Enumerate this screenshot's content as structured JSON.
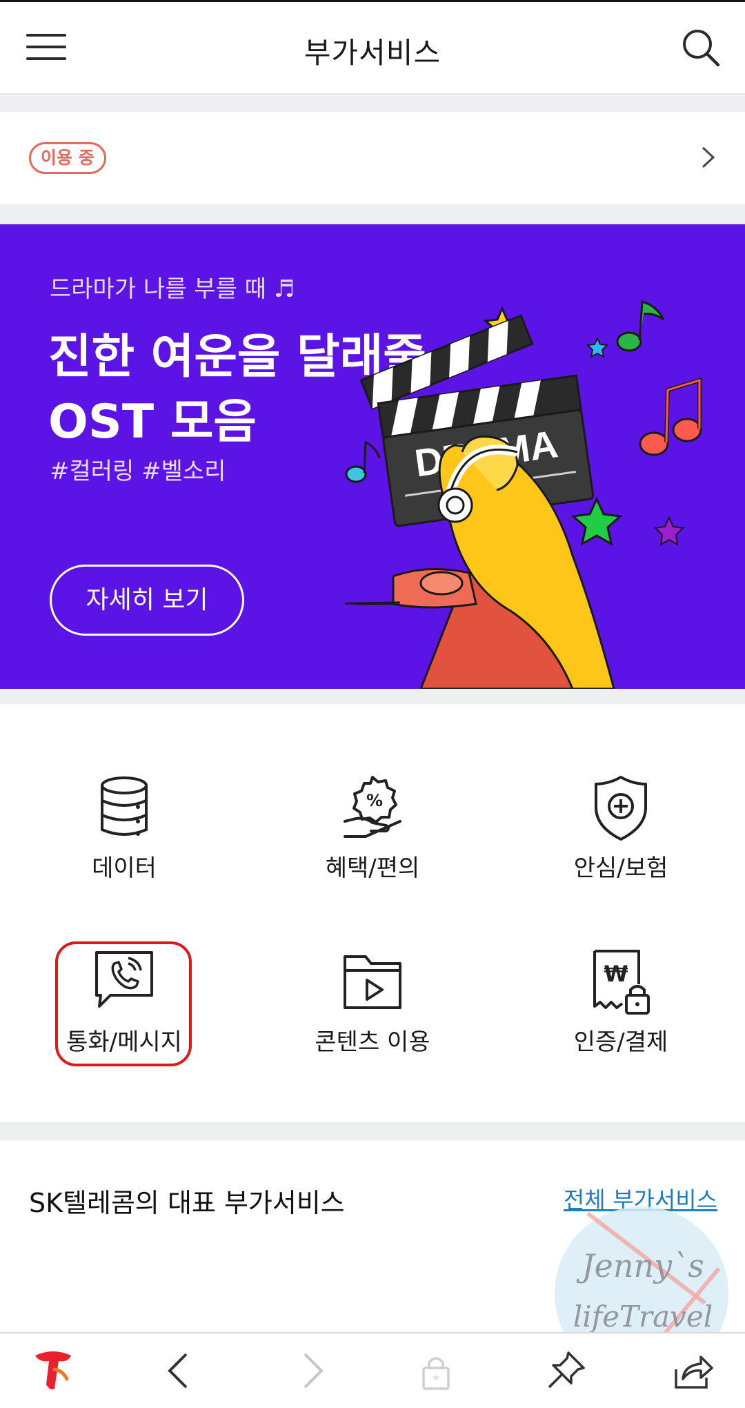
{
  "header": {
    "title": "부가서비스",
    "menu_icon": "hamburger-menu-icon",
    "search_icon": "search-icon"
  },
  "in_use": {
    "badge": "이용 중",
    "chevron_icon": "chevron-right-icon"
  },
  "banner": {
    "subtitle": "드라마가 나를 부를 때 ♬",
    "title_line1": "진한 여운을 달래줄",
    "title_line2": "OST 모음",
    "tags": "#컬러링  #벨소리",
    "button_label": "자세히 보기",
    "clapper_text": "DRAMA",
    "background_color": "#5b13e6"
  },
  "categories": [
    {
      "label": "데이터",
      "icon": "database-icon"
    },
    {
      "label": "혜택/편의",
      "icon": "discount-badge-hand-icon"
    },
    {
      "label": "안심/보험",
      "icon": "shield-plus-icon"
    },
    {
      "label": "통화/메시지",
      "icon": "phone-message-icon",
      "highlighted": true
    },
    {
      "label": "콘텐츠 이용",
      "icon": "video-folder-icon"
    },
    {
      "label": "인증/결제",
      "icon": "won-receipt-lock-icon"
    }
  ],
  "representative": {
    "title": "SK텔레콤의 대표 부가서비스",
    "link": "전체 부가서비스"
  },
  "watermark": {
    "line1": "Jenny`s",
    "line2": "lifeTravel"
  },
  "bottom_nav": [
    {
      "icon": "t-logo-icon"
    },
    {
      "icon": "back-arrow-icon"
    },
    {
      "icon": "forward-arrow-icon"
    },
    {
      "icon": "lock-icon"
    },
    {
      "icon": "pin-icon"
    },
    {
      "icon": "share-icon"
    }
  ],
  "colors": {
    "accent_red": "#e01818",
    "badge": "#e06a5b",
    "link": "#1f7dc1"
  }
}
